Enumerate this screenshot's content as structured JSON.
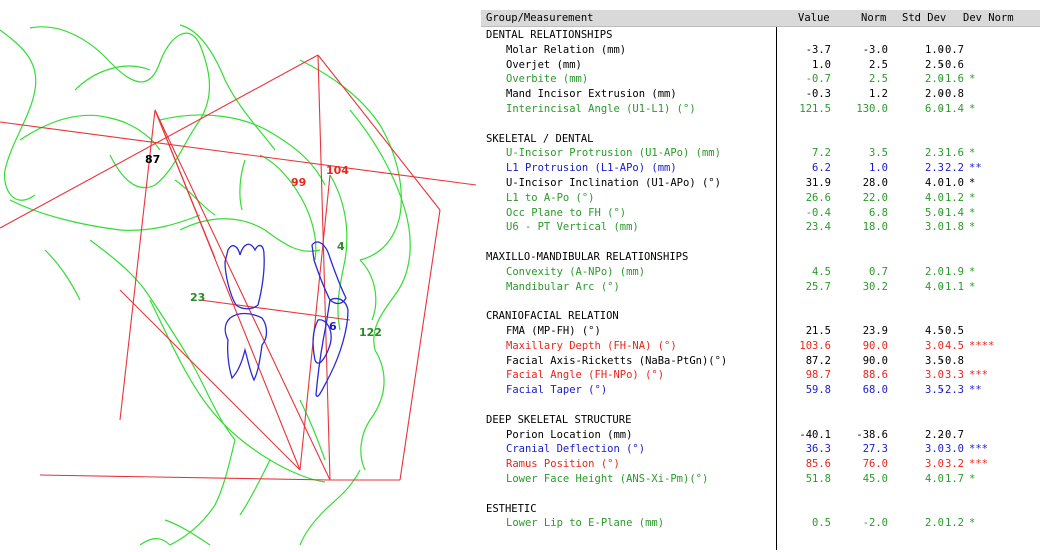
{
  "tracing": {
    "angle_labels": [
      {
        "text": "87",
        "color": "#000000"
      },
      {
        "text": "99",
        "color": "#e8251c"
      },
      {
        "text": "104",
        "color": "#e8251c"
      },
      {
        "text": "4",
        "color": "#2a8a2a"
      },
      {
        "text": "23",
        "color": "#2a8a2a"
      },
      {
        "text": "6",
        "color": "#1a1acc"
      },
      {
        "text": "122",
        "color": "#2a8a2a"
      }
    ],
    "colors": {
      "soft_tissue": "#33dd33",
      "planes": "#e8343a",
      "teeth": "#2a2ad6"
    }
  },
  "table": {
    "headers": {
      "group": "Group/Measurement",
      "value": "Value",
      "norm": "Norm",
      "sd": "Std Dev",
      "dev": "Dev Norm"
    },
    "rows": [
      {
        "type": "section",
        "name": "DENTAL RELATIONSHIPS"
      },
      {
        "type": "meas",
        "name": "Molar Relation (mm)",
        "value": "-3.7",
        "norm": "-3.0",
        "sd": "1.0",
        "dev": "-0.7",
        "stars": "",
        "color": "black"
      },
      {
        "type": "meas",
        "name": "Overjet (mm)",
        "value": "1.0",
        "norm": "2.5",
        "sd": "2.5",
        "dev": "-0.6",
        "stars": "",
        "color": "black"
      },
      {
        "type": "meas",
        "name": "Overbite (mm)",
        "value": "-0.7",
        "norm": "2.5",
        "sd": "2.0",
        "dev": "-1.6",
        "stars": "*",
        "color": "green"
      },
      {
        "type": "meas",
        "name": "Mand Incisor Extrusion (mm)",
        "value": "-0.3",
        "norm": "1.2",
        "sd": "2.0",
        "dev": "-0.8",
        "stars": "",
        "color": "black"
      },
      {
        "type": "meas",
        "name": "Interincisal Angle (U1-L1) (°)",
        "value": "121.5",
        "norm": "130.0",
        "sd": "6.0",
        "dev": "-1.4",
        "stars": "*",
        "color": "green"
      },
      {
        "type": "blank"
      },
      {
        "type": "section",
        "name": "SKELETAL / DENTAL"
      },
      {
        "type": "meas",
        "name": "U-Incisor Protrusion (U1-APo) (mm)",
        "value": "7.2",
        "norm": "3.5",
        "sd": "2.3",
        "dev": "1.6",
        "stars": "*",
        "color": "green"
      },
      {
        "type": "meas",
        "name": "L1 Protrusion (L1-APo) (mm)",
        "value": "6.2",
        "norm": "1.0",
        "sd": "2.3",
        "dev": "2.2",
        "stars": "**",
        "color": "blue"
      },
      {
        "type": "meas",
        "name": "U-Incisor Inclination (U1-APo) (°)",
        "value": "31.9",
        "norm": "28.0",
        "sd": "4.0",
        "dev": "1.0",
        "stars": "*",
        "color": "black"
      },
      {
        "type": "meas",
        "name": "L1 to A-Po (°)",
        "value": "26.6",
        "norm": "22.0",
        "sd": "4.0",
        "dev": "1.2",
        "stars": "*",
        "color": "green"
      },
      {
        "type": "meas",
        "name": "Occ Plane to FH (°)",
        "value": "-0.4",
        "norm": "6.8",
        "sd": "5.0",
        "dev": "-1.4",
        "stars": "*",
        "color": "green"
      },
      {
        "type": "meas",
        "name": "U6 - PT Vertical (mm)",
        "value": "23.4",
        "norm": "18.0",
        "sd": "3.0",
        "dev": "1.8",
        "stars": "*",
        "color": "green"
      },
      {
        "type": "blank"
      },
      {
        "type": "section",
        "name": "MAXILLO-MANDIBULAR RELATIONSHIPS"
      },
      {
        "type": "meas",
        "name": "Convexity (A-NPo) (mm)",
        "value": "4.5",
        "norm": "0.7",
        "sd": "2.0",
        "dev": "1.9",
        "stars": "*",
        "color": "green"
      },
      {
        "type": "meas",
        "name": "Mandibular Arc (°)",
        "value": "25.7",
        "norm": "30.2",
        "sd": "4.0",
        "dev": "-1.1",
        "stars": "*",
        "color": "green"
      },
      {
        "type": "blank"
      },
      {
        "type": "section",
        "name": "CRANIOFACIAL RELATION"
      },
      {
        "type": "meas",
        "name": "FMA (MP-FH) (°)",
        "value": "21.5",
        "norm": "23.9",
        "sd": "4.5",
        "dev": "-0.5",
        "stars": "",
        "color": "black"
      },
      {
        "type": "meas",
        "name": "Maxillary Depth (FH-NA) (°)",
        "value": "103.6",
        "norm": "90.0",
        "sd": "3.0",
        "dev": "4.5",
        "stars": "****",
        "color": "red"
      },
      {
        "type": "meas",
        "name": "Facial Axis-Ricketts (NaBa-PtGn)(°)",
        "value": "87.2",
        "norm": "90.0",
        "sd": "3.5",
        "dev": "-0.8",
        "stars": "",
        "color": "black"
      },
      {
        "type": "meas",
        "name": "Facial Angle (FH-NPo) (°)",
        "value": "98.7",
        "norm": "88.6",
        "sd": "3.0",
        "dev": "3.3",
        "stars": "***",
        "color": "red"
      },
      {
        "type": "meas",
        "name": "Facial Taper (°)",
        "value": "59.8",
        "norm": "68.0",
        "sd": "3.5",
        "dev": "-2.3",
        "stars": "**",
        "color": "blue"
      },
      {
        "type": "blank"
      },
      {
        "type": "section",
        "name": "DEEP SKELETAL STRUCTURE"
      },
      {
        "type": "meas",
        "name": "Porion Location (mm)",
        "value": "-40.1",
        "norm": "-38.6",
        "sd": "2.2",
        "dev": "-0.7",
        "stars": "",
        "color": "black"
      },
      {
        "type": "meas",
        "name": "Cranial Deflection (°)",
        "value": "36.3",
        "norm": "27.3",
        "sd": "3.0",
        "dev": "3.0",
        "stars": "***",
        "color": "blue"
      },
      {
        "type": "meas",
        "name": "Ramus Position (°)",
        "value": "85.6",
        "norm": "76.0",
        "sd": "3.0",
        "dev": "3.2",
        "stars": "***",
        "color": "red"
      },
      {
        "type": "meas",
        "name": "Lower Face Height (ANS-Xi-Pm)(°)",
        "value": "51.8",
        "norm": "45.0",
        "sd": "4.0",
        "dev": "1.7",
        "stars": "*",
        "color": "green"
      },
      {
        "type": "blank"
      },
      {
        "type": "section",
        "name": "ESTHETIC"
      },
      {
        "type": "meas",
        "name": "Lower Lip to E-Plane (mm)",
        "value": "0.5",
        "norm": "-2.0",
        "sd": "2.0",
        "dev": "1.2",
        "stars": "*",
        "color": "green"
      }
    ]
  }
}
